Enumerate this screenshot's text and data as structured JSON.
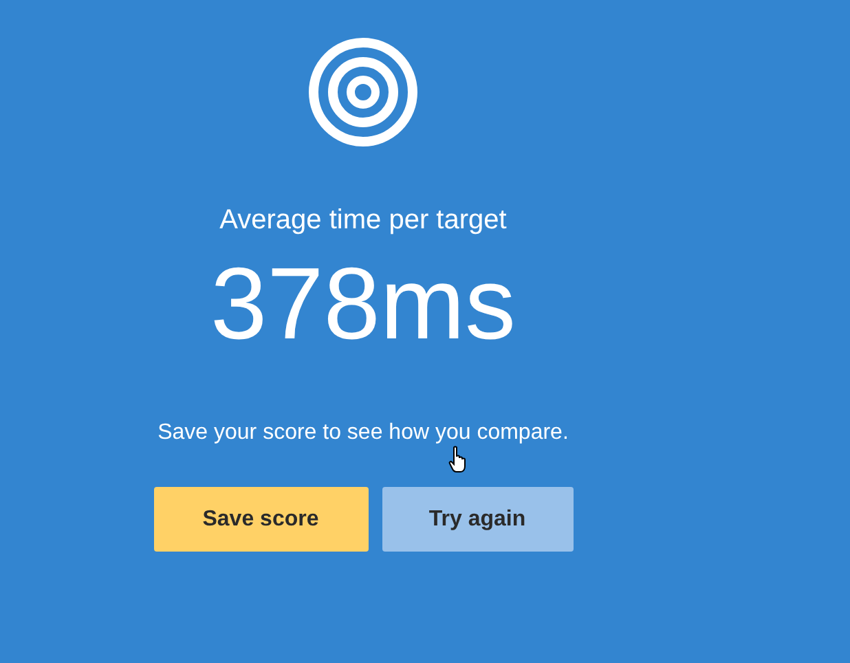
{
  "result": {
    "label": "Average time per target",
    "value": "378ms",
    "message": "Save your score to see how you compare."
  },
  "buttons": [
    {
      "label": "Save score",
      "kind": "primary"
    },
    {
      "label": "Try again",
      "kind": "secondary"
    }
  ]
}
